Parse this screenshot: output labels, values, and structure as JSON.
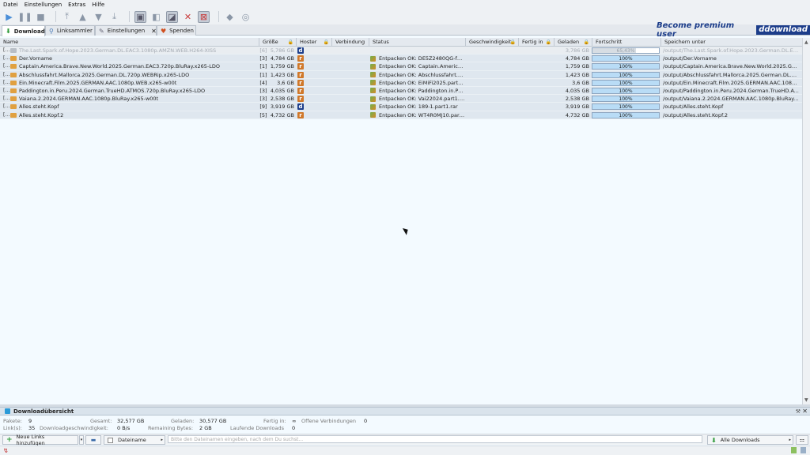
{
  "menu": [
    "Datei",
    "Einstellungen",
    "Extras",
    "Hilfe"
  ],
  "tabs": [
    {
      "label": "Download",
      "icon": "download-arrow-icon",
      "active": true
    },
    {
      "label": "Linksammler",
      "icon": "linkgrabber-icon",
      "active": false
    },
    {
      "label": "Einstellungen",
      "icon": "settings-icon",
      "active": false,
      "close": "✕"
    },
    {
      "label": "Spenden",
      "icon": "heart-icon",
      "active": false
    }
  ],
  "premium": {
    "text": "Become premium user",
    "brand": "ddownload"
  },
  "columns": [
    "Name",
    "Größe",
    "Hoster",
    "Verbindung",
    "Status",
    "Geschwindigkeit",
    "Fertig in",
    "Geladen",
    "Fortschritt",
    "Speichern unter"
  ],
  "packages": [
    {
      "name": "The.Last.Spark.of.Hope.2023.German.DL.EAC3.1080p.AMZN.WEB.H264-XISS",
      "count": "[6]",
      "size": "5,786 GB",
      "hoster": "d",
      "status": "",
      "loaded": "3,786 GB",
      "progress": "65,43%",
      "pct": 0.6543,
      "path": "/output/The.Last.Spark.of.Hope.2023.German.DL.EA...",
      "first": true
    },
    {
      "name": "Der.Vorname",
      "count": "[3]",
      "size": "4,784 GB",
      "hoster": "r",
      "status": "Entpacken OK: DE5Z2480QG-funn...",
      "loaded": "4,784 GB",
      "progress": "100%",
      "pct": 1,
      "path": "/output/Der.Vorname"
    },
    {
      "name": "Captain.America.Brave.New.World.2025.German.EAC3.720p.BluRay.x265-LDO",
      "count": "[1]",
      "size": "1,759 GB",
      "hoster": "r",
      "status": "Entpacken OK: Captain.America.B...",
      "loaded": "1,759 GB",
      "progress": "100%",
      "pct": 1,
      "path": "/output/Captain.America.Brave.New.World.2025.Ger..."
    },
    {
      "name": "Abschlussfahrt.Mallorca.2025.German.DL.720p.WEBRip.x265-LDO",
      "count": "[1]",
      "size": "1,423 GB",
      "hoster": "r",
      "status": "Entpacken OK: Abschlussfahrt.Ma...",
      "loaded": "1,423 GB",
      "progress": "100%",
      "pct": 1,
      "path": "/output/Abschlussfahrt.Mallorca.2025.German.DL.72..."
    },
    {
      "name": "Ein.Minecraft.Film.2025.GERMAN.AAC.1080p.WEB.x265-w00t",
      "count": "[4]",
      "size": "3,6 GB",
      "hoster": "r",
      "status": "Entpacken OK: EiMiFi2025.part1.rar",
      "loaded": "3,6 GB",
      "progress": "100%",
      "pct": 1,
      "path": "/output/Ein.Minecraft.Film.2025.GERMAN.AAC.1080p...."
    },
    {
      "name": "Paddington.in.Peru.2024.German.TrueHD.ATMOS.720p.BluRay.x265-LDO",
      "count": "[3]",
      "size": "4,035 GB",
      "hoster": "r",
      "status": "Entpacken OK: Paddington.in.Per...",
      "loaded": "4,035 GB",
      "progress": "100%",
      "pct": 1,
      "path": "/output/Paddington.in.Peru.2024.German.TrueHD.AT..."
    },
    {
      "name": "Vaiana.2.2024.GERMAN.AAC.1080p.BluRay.x265-w00t",
      "count": "[3]",
      "size": "2,538 GB",
      "hoster": "r",
      "status": "Entpacken OK: Vai22024.part1.rar",
      "loaded": "2,538 GB",
      "progress": "100%",
      "pct": 1,
      "path": "/output/Vaiana.2.2024.GERMAN.AAC.1080p.BluRay.x2..."
    },
    {
      "name": "Alles.steht.Kopf",
      "count": "[9]",
      "size": "3,919 GB",
      "hoster": "d",
      "status": "Entpacken OK: 189-1.part1.rar",
      "loaded": "3,919 GB",
      "progress": "100%",
      "pct": 1,
      "path": "/output/Alles.steht.Kopf"
    },
    {
      "name": "Alles.steht.Kopf.2",
      "count": "[5]",
      "size": "4,732 GB",
      "hoster": "r",
      "status": "Entpacken OK: WT4R0MJ10.part1.rar",
      "loaded": "4,732 GB",
      "progress": "100%",
      "pct": 1,
      "path": "/output/Alles.steht.Kopf.2"
    }
  ],
  "overview": {
    "title": "Downloadübersicht",
    "pakete_label": "Pakete:",
    "pakete": "9",
    "gesamt_label": "Gesamt:",
    "gesamt": "32,577 GB",
    "geladen_label": "Geladen:",
    "geladen": "30,577 GB",
    "fertig_label": "Fertig in:",
    "fertig": "∞",
    "offene_label": "Offene Verbindungen",
    "offene": "0",
    "links_label": "Link(s):",
    "links": "35",
    "speed_label": "Downloadgeschwindigkeit:",
    "speed": "0 B/s",
    "remaining_label": "Remaining Bytes:",
    "remaining": "2 GB",
    "laufende_label": "Laufende Downloads",
    "laufende": "0"
  },
  "bottom": {
    "add_links": "Neue Links hinzufügen",
    "filter": "Dateiname",
    "search_placeholder": "Bitte den Dateinamen eingeben, nach dem Du suchst...",
    "view": "Alle Downloads"
  }
}
